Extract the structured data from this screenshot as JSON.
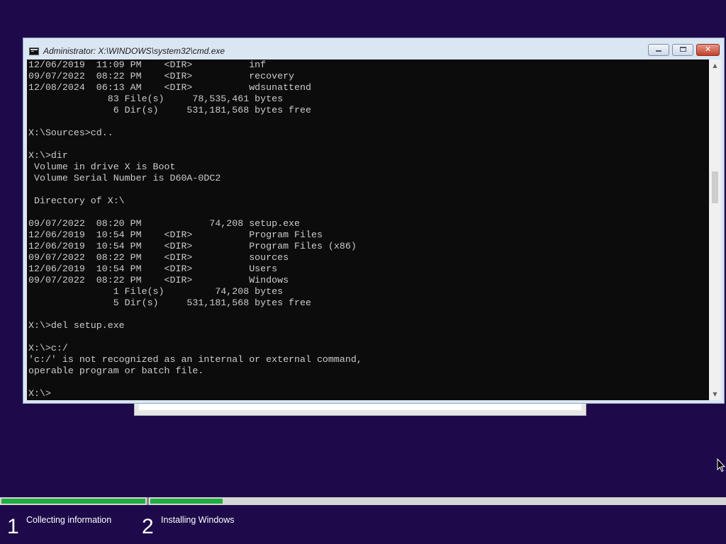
{
  "window": {
    "title": "Administrator: X:\\WINDOWS\\system32\\cmd.exe",
    "buttons": {
      "minimize": "minimize-icon",
      "maximize": "maximize-icon",
      "close": "close-icon"
    }
  },
  "console": {
    "lines": [
      "12/06/2019  11:09 PM    <DIR>          inf",
      "09/07/2022  08:22 PM    <DIR>          recovery",
      "12/08/2024  06:13 AM    <DIR>          wdsunattend",
      "              83 File(s)     78,535,461 bytes",
      "               6 Dir(s)     531,181,568 bytes free",
      "",
      "X:\\Sources>cd..",
      "",
      "X:\\>dir",
      " Volume in drive X is Boot",
      " Volume Serial Number is D60A-0DC2",
      "",
      " Directory of X:\\",
      "",
      "09/07/2022  08:20 PM            74,208 setup.exe",
      "12/06/2019  10:54 PM    <DIR>          Program Files",
      "12/06/2019  10:54 PM    <DIR>          Program Files (x86)",
      "09/07/2022  08:22 PM    <DIR>          sources",
      "12/06/2019  10:54 PM    <DIR>          Users",
      "09/07/2022  08:22 PM    <DIR>          Windows",
      "               1 File(s)         74,208 bytes",
      "               5 Dir(s)     531,181,568 bytes free",
      "",
      "X:\\>del setup.exe",
      "",
      "X:\\>c:/",
      "'c:/' is not recognized as an internal or external command,",
      "operable program or batch file.",
      "",
      "X:\\>"
    ],
    "colors": {
      "background": "#0c0c0c",
      "text": "#cccccc"
    }
  },
  "setup": {
    "steps": [
      {
        "number": "1",
        "label": "Collecting information",
        "progress": 1.0
      },
      {
        "number": "2",
        "label": "Installing Windows",
        "progress": 0.125
      }
    ],
    "colors": {
      "background": "#1e0a4a",
      "progress": "#20ad40"
    }
  }
}
